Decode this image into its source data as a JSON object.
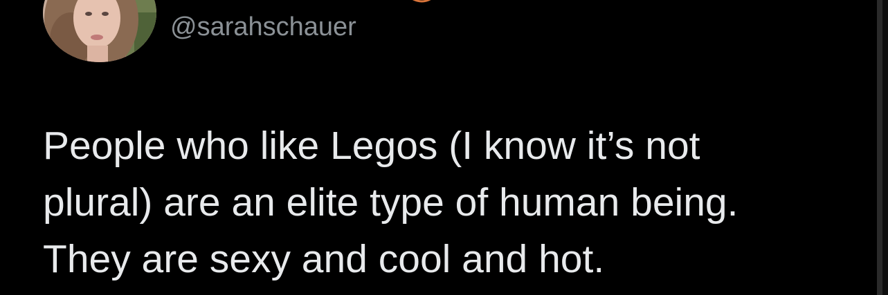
{
  "tweet": {
    "handle": "@sarahschauer",
    "text_lines": [
      "People who like Legos (I know it’s not",
      "plural) are an elite type of human being.",
      "They are sexy and cool and hot."
    ]
  },
  "colors": {
    "background": "#000000",
    "handle": "#8b9196",
    "text": "#e8eaec"
  },
  "icons": {
    "avatar": "profile-photo"
  }
}
